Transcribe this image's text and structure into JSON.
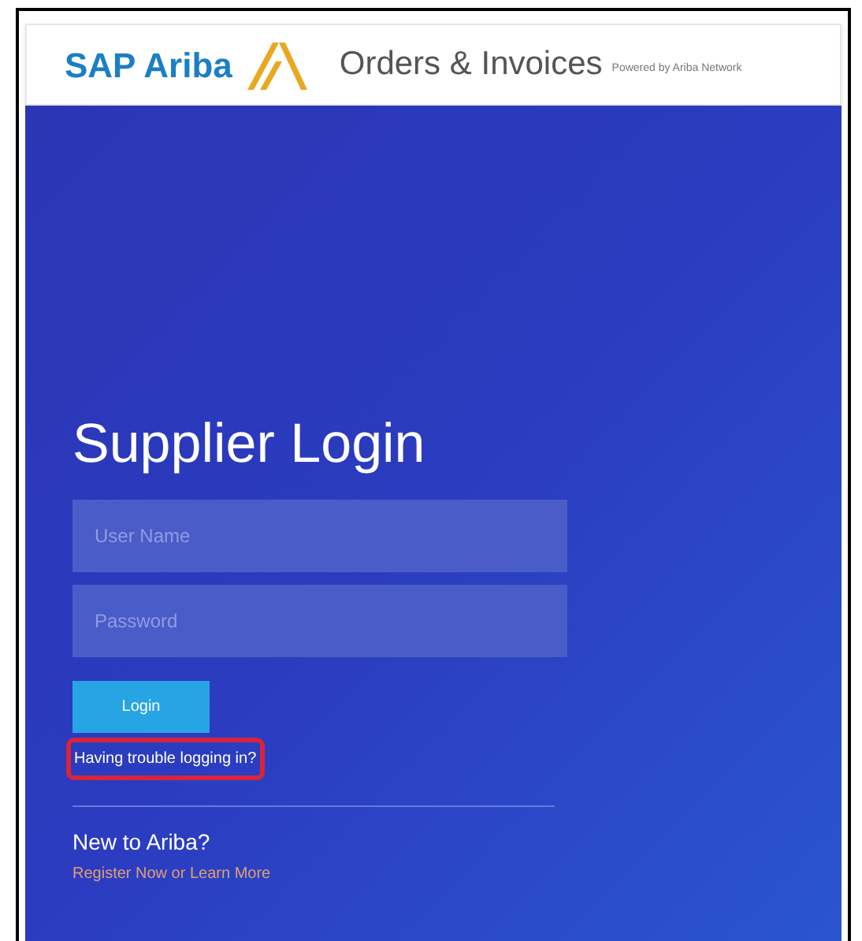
{
  "header": {
    "brand": "SAP Ariba",
    "product": "Orders & Invoices",
    "powered_by": "Powered by Ariba Network"
  },
  "login": {
    "title": "Supplier Login",
    "fields": [
      {
        "placeholder": "User Name"
      },
      {
        "placeholder": "Password"
      }
    ],
    "button": "Login",
    "help_link": {
      "label": "Having trouble logging in?",
      "highlighted": true
    },
    "new_heading": "New to Ariba?",
    "register_link": "Register Now or Learn More"
  }
}
